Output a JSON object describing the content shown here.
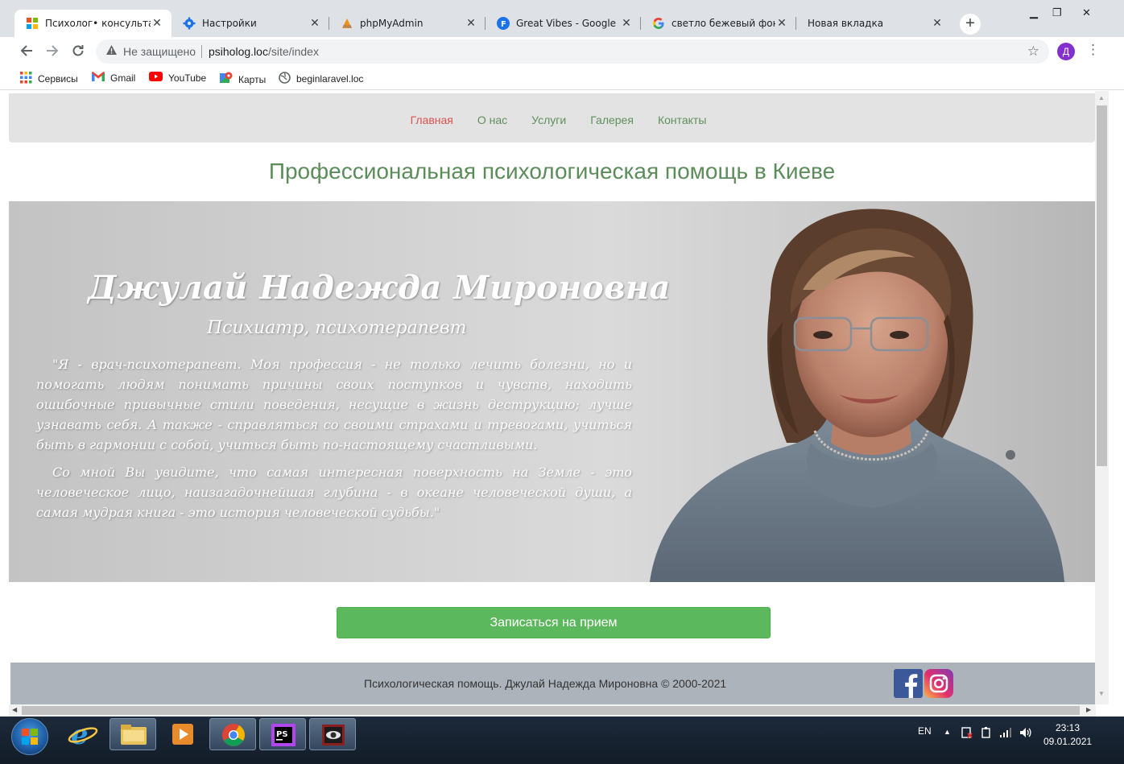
{
  "browser": {
    "tabs": [
      {
        "title": "Психолог• консультаци",
        "active": true
      },
      {
        "title": "Настройки",
        "active": false
      },
      {
        "title": "phpMyAdmin",
        "active": false
      },
      {
        "title": "Great Vibes - Google Fo",
        "active": false
      },
      {
        "title": "светло бежевый фон са",
        "active": false
      },
      {
        "title": "Новая вкладка",
        "active": false
      }
    ],
    "new_tab": "+",
    "close_glyph": "✕",
    "window_controls": {
      "minimize": "▁",
      "maximize": "❐",
      "close": "✕"
    },
    "address": {
      "security_label": "Не защищено",
      "url_host": "psiholog.loc",
      "url_path": "/site/index"
    },
    "profile_initial": "Д",
    "bookmarks": [
      "Сервисы",
      "Gmail",
      "YouTube",
      "Карты",
      "beginlaravel.loc"
    ]
  },
  "site": {
    "nav": [
      "Главная",
      "О нас",
      "Услуги",
      "Галерея",
      "Контакты"
    ],
    "nav_active_index": 0,
    "headline": "Профессиональная психологическая помощь в Киеве",
    "hero": {
      "name": "Джулай Надежда Мироновна",
      "role": "Психиатр, психотерапевт",
      "paragraph_1": "\"Я - врач-психотерапевт. Моя профессия - не только лечить болезни, но и помогать людям понимать причины своих поступков и чувств, находить ошибочные привычные стили поведения, несущие в жизнь деструкцию; лучше узнавать себя. А также - справляться со своими страхами и тревогами, учиться быть в гармонии с собой, учиться быть по-настоящему счастливыми.",
      "paragraph_2": "Со мной Вы увидите, что самая интересная поверхность на Земле - это человеческое лицо, наизагадочнейшая глубина - в океане человеческой души, а самая мудрая книга - это история человеческой судьбы.\""
    },
    "cta_label": "Записаться на прием",
    "footer_text": "Психологическая помощь. Джулай Надежда Мироновна © 2000-2021",
    "social": [
      "facebook-icon",
      "instagram-icon"
    ]
  },
  "taskbar": {
    "language": "EN",
    "time": "23:13",
    "date": "09.01.2021"
  },
  "colors": {
    "nav_link": "#5f8f5f",
    "nav_active": "#d9534f",
    "headline": "#5b8c5a",
    "cta": "#5cb85c",
    "footer_bg": "#adb3bb"
  }
}
